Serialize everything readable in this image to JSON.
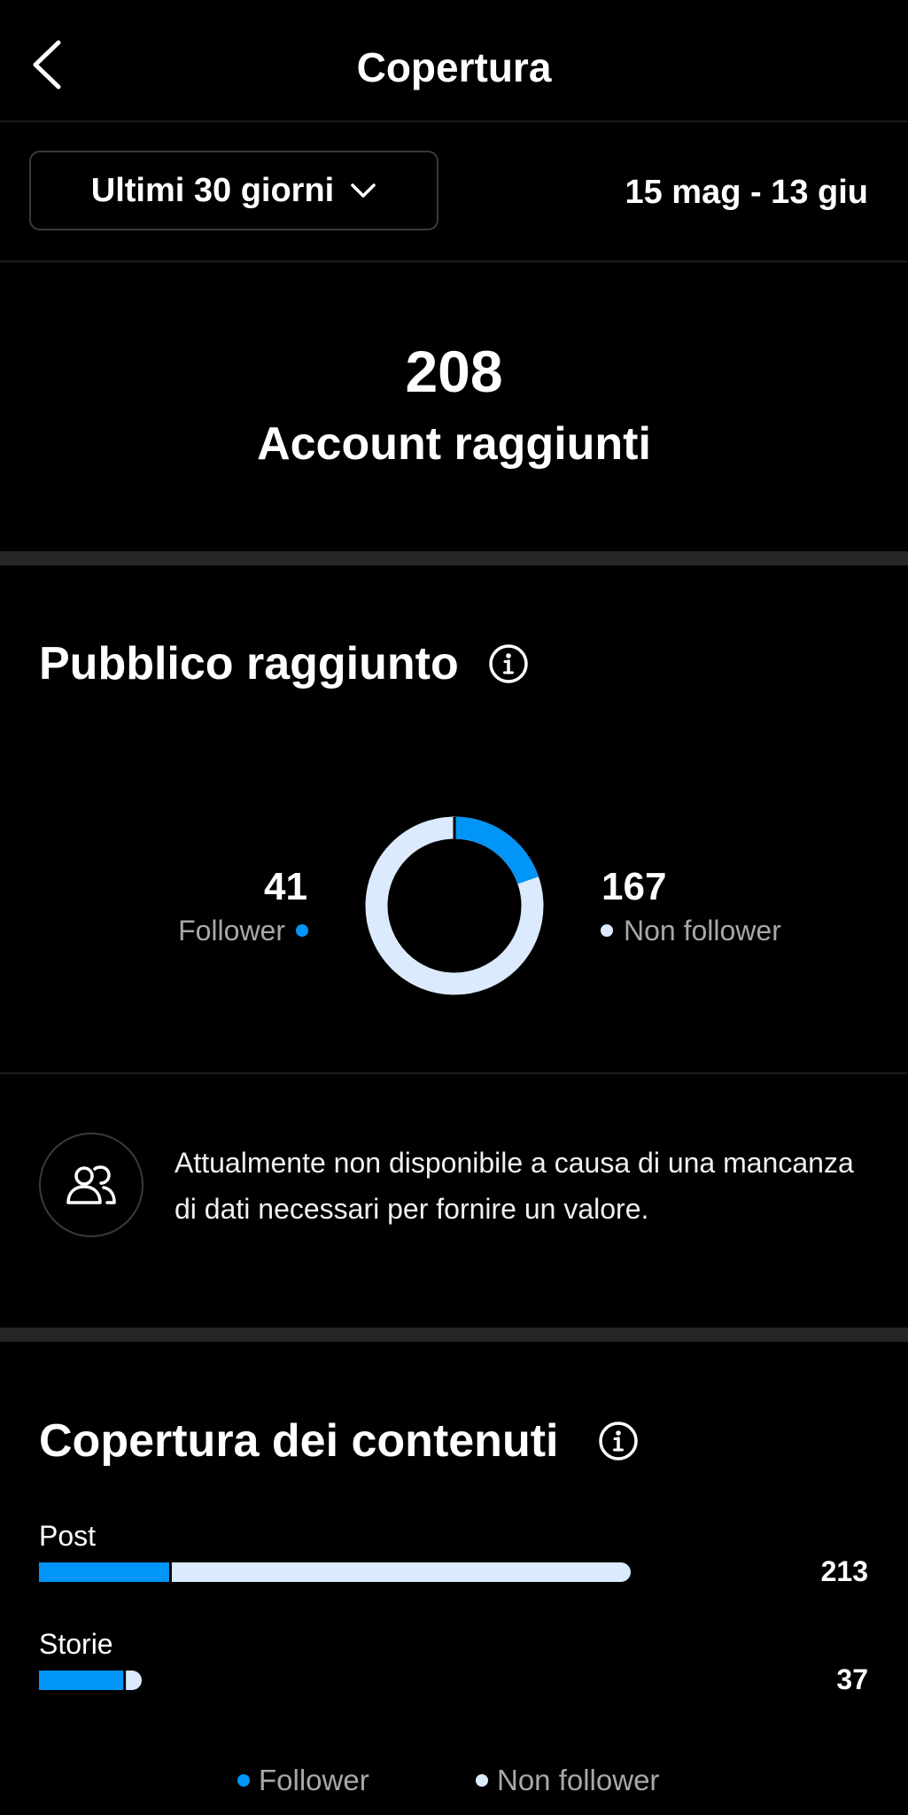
{
  "header": {
    "title": "Copertura"
  },
  "filters": {
    "range_label": "Ultimi 30 giorni",
    "date_range": "15 mag - 13 giu"
  },
  "summary": {
    "value": "208",
    "label": "Account raggiunti"
  },
  "audience": {
    "title": "Pubblico raggiunto",
    "follower_value": "41",
    "follower_label": "Follower",
    "non_follower_value": "167",
    "non_follower_label": "Non follower",
    "follower_fraction": 0.197
  },
  "unavailable": {
    "text": "Attualmente non disponibile a causa di una mancanza di dati necessari per fornire un valore."
  },
  "content_reach": {
    "title": "Copertura dei contenuti",
    "rows": [
      {
        "label": "Post",
        "value": "213",
        "total": 213,
        "follower_share": 0.22
      },
      {
        "label": "Storie",
        "value": "37",
        "total": 37,
        "follower_share": 0.82
      }
    ]
  },
  "legend": {
    "follower": "Follower",
    "non_follower": "Non follower"
  },
  "colors": {
    "follower": "#0095f6",
    "non_follower": "#dbeafc",
    "background": "#000000"
  }
}
